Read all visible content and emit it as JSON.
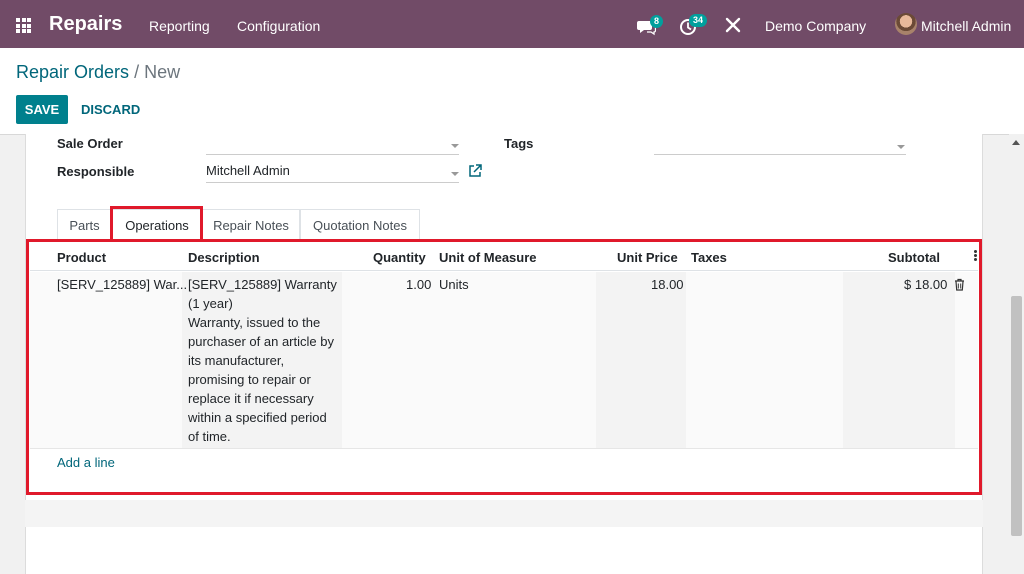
{
  "navbar": {
    "app_name": "Repairs",
    "menu": [
      "Reporting",
      "Configuration"
    ],
    "messages_badge": "8",
    "activities_badge": "34",
    "company": "Demo Company",
    "user": "Mitchell Admin",
    "color": "#714b67"
  },
  "breadcrumb": {
    "parent": "Repair Orders",
    "separator": "/",
    "current": "New"
  },
  "actions": {
    "save": "SAVE",
    "discard": "DISCARD"
  },
  "form": {
    "sale_order_label": "Sale Order",
    "sale_order_value": "",
    "tags_label": "Tags",
    "tags_value": "",
    "responsible_label": "Responsible",
    "responsible_value": "Mitchell Admin"
  },
  "tabs": [
    "Parts",
    "Operations",
    "Repair Notes",
    "Quotation Notes"
  ],
  "active_tab": "Operations",
  "table": {
    "headers": [
      "Product",
      "Description",
      "Quantity",
      "Unit of Measure",
      "Unit Price",
      "Taxes",
      "Subtotal"
    ],
    "rows": [
      {
        "product": "[SERV_125889] War...",
        "description_lines": [
          "[SERV_125889] Warranty",
          "(1 year)",
          "Warranty, issued to the",
          "purchaser of an article by",
          "its manufacturer,",
          "promising to repair or",
          "replace it if necessary",
          "within a specified period",
          "of time."
        ],
        "quantity": "1.00",
        "uom": "Units",
        "unit_price": "18.00",
        "taxes": "",
        "subtotal": "$ 18.00"
      }
    ],
    "add_line": "Add a line"
  },
  "colors": {
    "accent": "#00808d",
    "link": "#00667a",
    "highlight": "#e0192b"
  }
}
